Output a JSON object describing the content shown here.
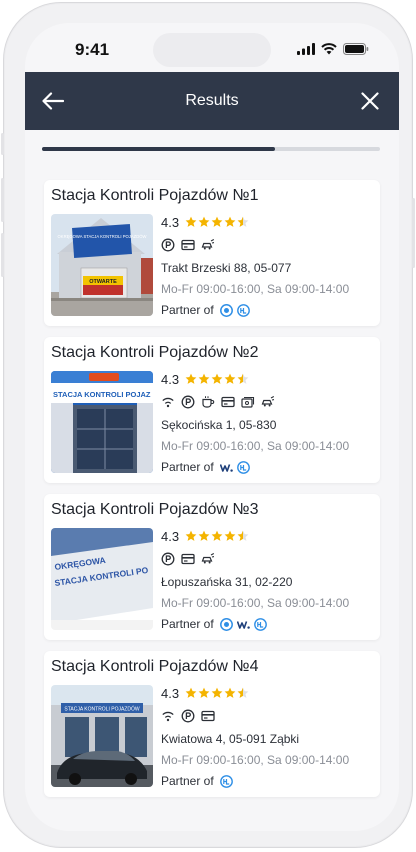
{
  "status_bar": {
    "time": "9:41"
  },
  "header": {
    "title": "Results"
  },
  "progress": {
    "value": 0.69
  },
  "colors": {
    "header_bg": "#2f3849",
    "star": "#f4b400",
    "partner_blue": "#2f8fe6"
  },
  "partner_label": "Partner of",
  "cards": [
    {
      "title": "Stacja Kontroli Pojazdów №1",
      "rating": "4.3",
      "stars": 4.5,
      "amenities": [
        "parking-icon",
        "card-payment-icon",
        "car-wash-icon"
      ],
      "address": "Trakt Brzeski 88, 05-077",
      "hours": "Mo-Fr 09:00-16:00, Sa 09:00-14:00",
      "partners": [
        "partner-a-logo",
        "partner-b-logo"
      ],
      "photo_sign": "OKRĘGOWA STACJA KONTROLI POJAZDÓW",
      "photo_banner": "OTWARTE"
    },
    {
      "title": "Stacja Kontroli Pojazdów №2",
      "rating": "4.3",
      "stars": 4.5,
      "amenities": [
        "wifi-icon",
        "parking-icon",
        "coffee-icon",
        "card-payment-icon",
        "cash-icon",
        "car-wash-icon"
      ],
      "address": "Sękocińska 1, 05-830",
      "hours": "Mo-Fr 09:00-16:00, Sa 09:00-14:00",
      "partners": [
        "partner-w-logo",
        "partner-b-logo"
      ],
      "photo_sign": "STACJA KONTROLI POJAZ"
    },
    {
      "title": "Stacja Kontroli Pojazdów №3",
      "rating": "4.3",
      "stars": 4.5,
      "amenities": [
        "parking-icon",
        "card-payment-icon",
        "car-wash-icon"
      ],
      "address": "Łopuszańska 31, 02-220",
      "hours": "Mo-Fr 09:00-16:00, Sa 09:00-14:00",
      "partners": [
        "partner-a-logo",
        "partner-w-logo",
        "partner-b-logo"
      ],
      "photo_sign_line1": "OKRĘGOWA",
      "photo_sign_line2": "STACJA KONTROLI PO"
    },
    {
      "title": "Stacja Kontroli Pojazdów №4",
      "rating": "4.3",
      "stars": 4.5,
      "amenities": [
        "wifi-icon",
        "parking-icon",
        "card-payment-icon"
      ],
      "address": "Kwiatowa 4, 05-091 Ząbki",
      "hours": "Mo-Fr 09:00-16:00, Sa 09:00-14:00",
      "partners": [
        "partner-b-logo"
      ],
      "photo_sign": "STACJA KONTROLI POJAZDÓW"
    }
  ]
}
